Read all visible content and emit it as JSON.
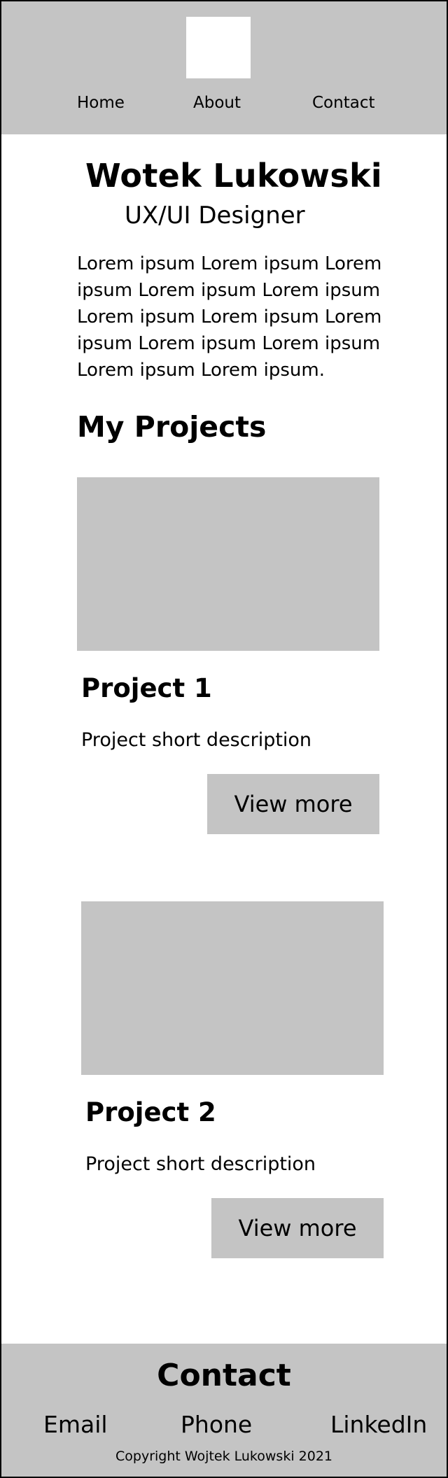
{
  "nav": {
    "items": [
      {
        "label": "Home"
      },
      {
        "label": "About"
      },
      {
        "label": "Contact"
      }
    ]
  },
  "intro": {
    "name": "Wotek Lukowski",
    "role": "UX/UI Designer",
    "bio": "Lorem ipsum Lorem ipsum Lorem ipsum Lorem ipsum Lorem ipsum Lorem ipsum Lorem ipsum Lorem ipsum Lorem ipsum Lorem ipsum Lorem ipsum Lorem ipsum."
  },
  "projects": {
    "title": "My Projects",
    "items": [
      {
        "title": "Project 1",
        "description": "Project short description",
        "button_label": "View more"
      },
      {
        "title": "Project 2",
        "description": "Project short description",
        "button_label": "View more"
      }
    ]
  },
  "footer": {
    "title": "Contact",
    "links": [
      {
        "label": "Email"
      },
      {
        "label": "Phone"
      },
      {
        "label": "LinkedIn"
      }
    ],
    "copyright": "Copyright Wojtek Lukowski 2021"
  },
  "colors": {
    "placeholder_gray": "#c4c4c4",
    "background": "#ffffff",
    "text": "#000000"
  }
}
